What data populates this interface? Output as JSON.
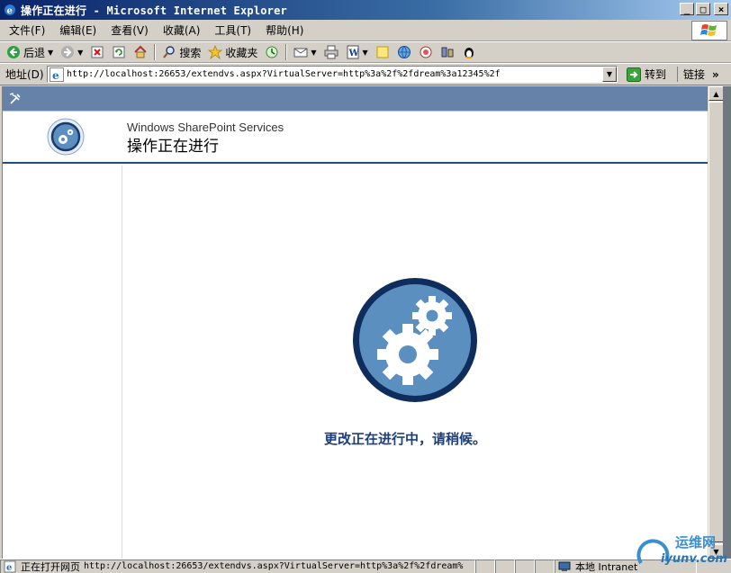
{
  "window": {
    "title": "操作正在进行 - Microsoft Internet Explorer",
    "minimize": "_",
    "maximize": "□",
    "close": "×"
  },
  "menu": [
    {
      "label": "文件(F)"
    },
    {
      "label": "编辑(E)"
    },
    {
      "label": "查看(V)"
    },
    {
      "label": "收藏(A)"
    },
    {
      "label": "工具(T)"
    },
    {
      "label": "帮助(H)"
    }
  ],
  "toolbar": {
    "back_label": "后退",
    "search_label": "搜索",
    "favorites_label": "收藏夹"
  },
  "address": {
    "label": "地址(D)",
    "url": "http://localhost:26653/extendvs.aspx?VirtualServer=http%3a%2f%2fdream%3a12345%2f",
    "go_label": "转到",
    "links_label": "链接"
  },
  "page": {
    "product_name": "Windows SharePoint Services",
    "title": "操作正在进行",
    "progress_message": "更改正在进行中，请稍候。"
  },
  "status": {
    "text": "正在打开网页",
    "url": "http://localhost:26653/extendvs.aspx?VirtualServer=http%3a%2f%2fdream%",
    "zone": "本地 Intranet"
  },
  "watermark": {
    "line1": "运维网",
    "line2": "iyunv.com"
  },
  "colors": {
    "title_gradient_start": "#0a246a",
    "sharepoint_bar": "#6782a8",
    "gear_blue": "#5b8fc0",
    "gear_ring": "#1b3a6b",
    "message_color": "#1f3f7a"
  }
}
